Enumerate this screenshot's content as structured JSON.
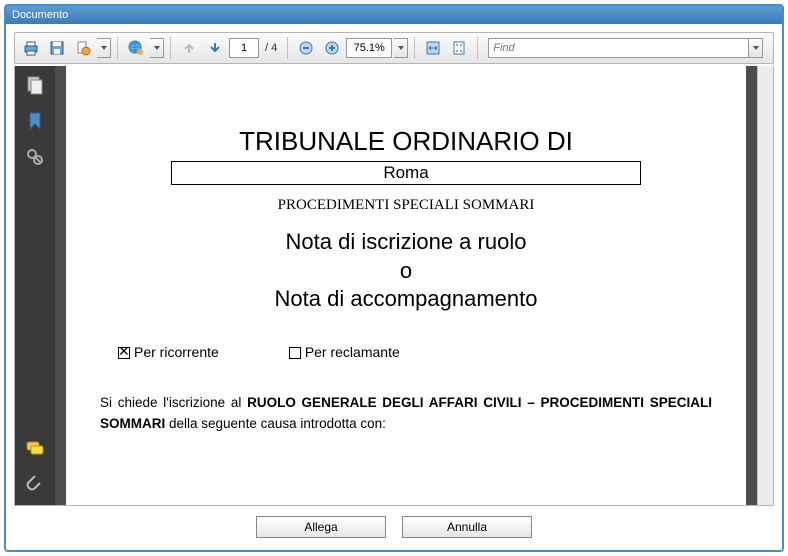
{
  "window": {
    "title": "Documento"
  },
  "toolbar": {
    "page_current": "1",
    "page_total": "/ 4",
    "zoom": "75.1%",
    "find_placeholder": "Find"
  },
  "document": {
    "title": "TRIBUNALE ORDINARIO DI",
    "city": "Roma",
    "subtitle": "PROCEDIMENTI SPECIALI SOMMARI",
    "heading_line1": "Nota di iscrizione a ruolo",
    "heading_line2": "o",
    "heading_line3": "Nota di accompagnamento",
    "check1_label": "Per ricorrente",
    "check1_checked": true,
    "check2_label": "Per reclamante",
    "check2_checked": false,
    "body_prefix": "Si chiede l'iscrizione al ",
    "body_bold": "RUOLO GENERALE DEGLI AFFARI CIVILI – PROCEDIMENTI SPECIALI SOMMARI",
    "body_suffix": " della seguente causa introdotta con:"
  },
  "footer": {
    "attach": "Allega",
    "cancel": "Annulla"
  }
}
